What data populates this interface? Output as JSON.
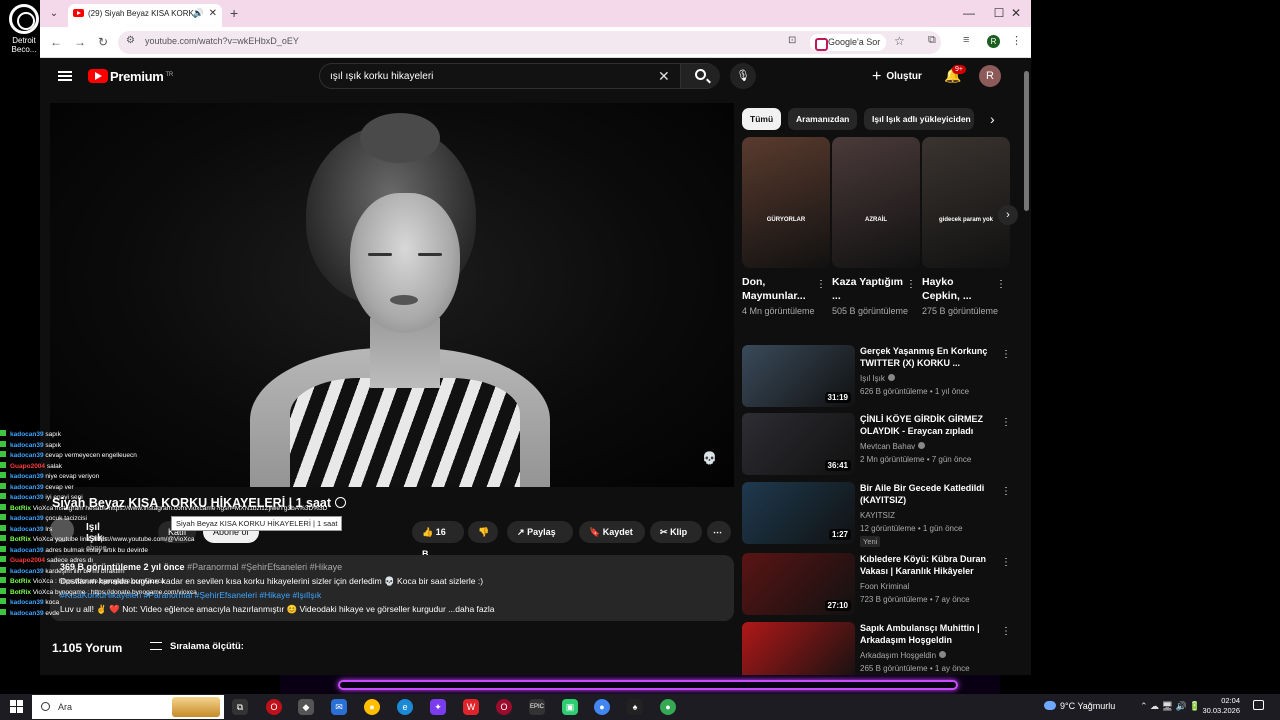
{
  "desktop": {
    "icon_label": "Detroit Beco..."
  },
  "browser": {
    "tab_title": "(29) Siyah Beyaz KISA KORK",
    "url": "youtube.com/watch?v=wkEHbxD_oEY",
    "google_sor": "Google'a Sor",
    "profile_initial": "R"
  },
  "youtube": {
    "brand": "Premium",
    "brand_sup": "TR",
    "search_query": "ışıl ışık korku hikayeleri",
    "create_label": "Oluştur",
    "notif_badge": "9+",
    "avatar_initial": "R"
  },
  "video": {
    "title": "Siyah Beyaz KISA KORKU HİKAYELERİ | 1 saat",
    "tooltip": "Siyah Beyaz KISA KORKU HİKAYELERİ | 1 saat",
    "channel_name": "Işıl Işık",
    "channel_subs": "1,7 Mn abone",
    "join_label": "Katıl",
    "subscribe_label": "Abone ol",
    "likes": "16 B",
    "share_label": "Paylaş",
    "save_label": "Kaydet",
    "clip_label": "Klip",
    "views_meta": "369 B görüntüleme  2 yıl önce",
    "hashtags_top": "#Paranormal #ŞehirEfsaneleri #Hikaye",
    "desc_line1": "Dostlarım kanalda bugüne kadar en sevilen kısa korku hikayelerini sizler için derledim 💀 Koca bir saat sizlerle :)",
    "desc_hashtags": "#KısaKorkuHikayeleri #Paranormal #ŞehirEfsaneleri #Hikaye #IşılIşık",
    "desc_line3_prefix": "Luv u all! ✌️ ❤️",
    "desc_line3": "Not: Video eğlence amacıyla hazırlanmıştır 😊  Videodaki hikaye ve görseller  kurgudur ...daha fazla",
    "comments_count": "1.105 Yorum",
    "sort_label": "Sıralama ölçütü:"
  },
  "chips": [
    "Tümü",
    "Aramanızdan",
    "Işıl Işık adlı yükleyiciden"
  ],
  "shorts": [
    {
      "title": "Don, Maymunlar...",
      "views": "4 Mn görüntüleme",
      "label": "GÜRYORLAR",
      "color": "#5a3b2e"
    },
    {
      "title": "Kaza Yaptığım ...",
      "views": "505 B görüntüleme",
      "label": "AZRAİL",
      "color": "#4b3a3a"
    },
    {
      "title": "Hayko Cepkin, ...",
      "views": "275 B görüntüleme",
      "label": "gidecek param yok",
      "color": "#3a3430"
    }
  ],
  "recommended": [
    {
      "title": "Gerçek Yaşanmış En Korkunç TWITTER (X) KORKU ...",
      "channel": "Işıl Işık",
      "meta": "626 B görüntüleme • 1 yıl önce",
      "duration": "31:19",
      "thumb": "#3a4a5a",
      "verified": true,
      "new": ""
    },
    {
      "title": "ÇİNLİ KÖYE GİRDİK GİRMEZ OLAYDIK - Eraycan zıpladı",
      "channel": "Mevtcan Bahav",
      "meta": "2 Mn görüntüleme • 7 gün önce",
      "duration": "36:41",
      "thumb": "#2d2d33",
      "verified": true,
      "new": ""
    },
    {
      "title": "Bir Aile Bir Gecede Katledildi (KAYITSIZ)",
      "channel": "KAYITSIZ",
      "meta": "12 görüntüleme • 1 gün önce",
      "duration": "1:27",
      "thumb": "#1e3a4f",
      "verified": false,
      "new": "Yeni"
    },
    {
      "title": "Kıbledere Köyü: Kübra Duran Vakası | Karanlık Hikâyeler",
      "channel": "Foon Kriminal",
      "meta": "723 B görüntüleme • 7 ay önce",
      "duration": "27:10",
      "thumb": "#5a1414",
      "verified": false,
      "new": ""
    },
    {
      "title": "Sapık Ambulansçı Muhittin | Arkadaşım Hoşgeldin",
      "channel": "Arkadaşım Hoşgeldin",
      "meta": "265 B görüntüleme • 1 ay önce",
      "duration": "",
      "thumb": "#b01818",
      "verified": true,
      "new": ""
    }
  ],
  "chat": [
    {
      "user": "kadocan39",
      "msg": "sapık",
      "color": "#3ea6ff"
    },
    {
      "user": "kadocan39",
      "msg": "sapık",
      "color": "#3ea6ff"
    },
    {
      "user": "kadocan39",
      "msg": "cevap vermeyecen engelleuecn",
      "color": "#3ea6ff"
    },
    {
      "user": "Guapo2004",
      "msg": "salak",
      "color": "#ff3b3b"
    },
    {
      "user": "kadocan39",
      "msg": "niye cevap veriyon",
      "color": "#3ea6ff"
    },
    {
      "user": "kadocan39",
      "msg": "cevap ver",
      "color": "#3ea6ff"
    },
    {
      "user": "kadocan39",
      "msg": "iyi enayi seni",
      "color": "#3ea6ff"
    },
    {
      "user": "BotRix",
      "msg": "VioXca instagram hesabı: https://www.instagram.com/vioxcame?igsh=MXN1bzl1ZjlweTg3bA%3D%3D",
      "color": "#7cff4f"
    },
    {
      "user": "kadocan39",
      "msg": "çocuk tacizcisi",
      "color": "#3ea6ff"
    },
    {
      "user": "kadocan39",
      "msg": "lrs",
      "color": "#3ea6ff"
    },
    {
      "user": "BotRix",
      "msg": "VioXca youtube link: https://www.youtube.com/@VioXca",
      "color": "#7cff4f"
    },
    {
      "user": "kadocan39",
      "msg": "adres bulmak kolay artık bu devirde",
      "color": "#3ea6ff"
    },
    {
      "user": "Guapo2004",
      "msg": "sadece adres dı",
      "color": "#ff3b3b"
    },
    {
      "user": "kadocan39",
      "msg": "kardeşim ilin bri mi bıraktım",
      "color": "#3ea6ff"
    },
    {
      "user": "BotRix",
      "msg": "VioXca : https://donate.bynogame.com/vioxca",
      "color": "#7cff4f"
    },
    {
      "user": "BotRix",
      "msg": "VioXca bynogame : https://donate.bynogame.com/vioxca",
      "color": "#7cff4f"
    },
    {
      "user": "kadocan39",
      "msg": "koca",
      "color": "#3ea6ff"
    },
    {
      "user": "kadocan39",
      "msg": "evde",
      "color": "#3ea6ff"
    }
  ],
  "taskbar": {
    "search_placeholder": "Ara",
    "weather": "9°C  Yağmurlu",
    "time": "02:04",
    "date": "30.03.2026"
  }
}
